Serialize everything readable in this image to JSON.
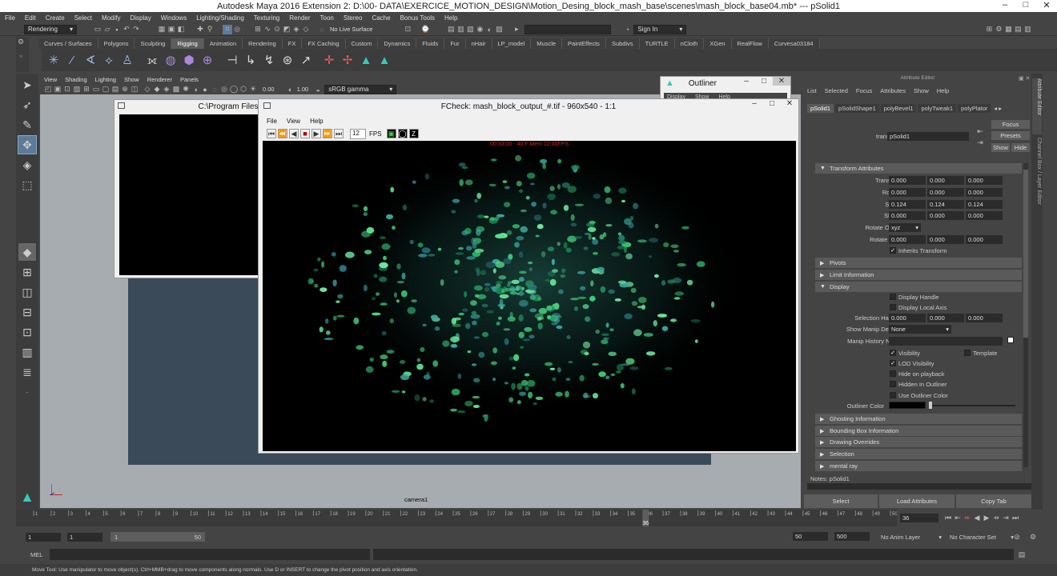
{
  "title": "Autodesk Maya 2016 Extension 2: D:\\00- DATA\\EXERCICE_MOTION_DESIGN\\Motion_Desing_block_mash_base\\scenes\\mash_block_base04.mb*  ---  pSolid1",
  "window_controls": [
    "–",
    "□",
    "✕"
  ],
  "menus": [
    "File",
    "Edit",
    "Create",
    "Select",
    "Modify",
    "Display",
    "Windows",
    "Lighting/Shading",
    "Texturing",
    "Render",
    "Toon",
    "Stereo",
    "Cache",
    "Bonus Tools",
    "Help"
  ],
  "status": {
    "mode": "Rendering",
    "live_surface": "No Live Surface",
    "sign_in": "Sign In"
  },
  "shelf_tabs": [
    "Curves / Surfaces",
    "Polygons",
    "Sculpting",
    "Rigging",
    "Animation",
    "Rendering",
    "FX",
    "FX Caching",
    "Custom",
    "Dynamics",
    "Fluids",
    "Fur",
    "nHair",
    "LP_model",
    "Muscle",
    "PaintEffects",
    "Subdivs",
    "TURTLE",
    "nCloth",
    "XGen",
    "RealFlow",
    "Curvesa03184"
  ],
  "shelf_selected": "Rigging",
  "viewport": {
    "menus": [
      "View",
      "Shading",
      "Lighting",
      "Show",
      "Renderer",
      "Panels"
    ],
    "exposure": "0.00",
    "gamma": "1.00",
    "colorspace": "sRGB gamma",
    "camera": "camera1"
  },
  "outliner": {
    "title": "Outliner",
    "menus": [
      "Display",
      "Show",
      "Help"
    ]
  },
  "program_files": {
    "title": "C:\\Program Files"
  },
  "fcheck": {
    "title": "FCheck: mash_block_output_#.tif - 960x540 - 1:1",
    "menus": [
      "File",
      "View",
      "Help"
    ],
    "fps": "12",
    "fps_label": "FPS",
    "overlay": "00:33:00 - 40 F Mem 12.00FPS"
  },
  "ae": {
    "header": "Attribute Editor",
    "menus": [
      "List",
      "Selected",
      "Focus",
      "Attributes",
      "Show",
      "Help"
    ],
    "tabs": [
      "pSolid1",
      "pSolidShape1",
      "polyBevel1",
      "polyTweak1",
      "polyPlator"
    ],
    "side_buttons": [
      "Focus",
      "Presets",
      "Show",
      "Hide"
    ],
    "transform_label": "transform:",
    "transform_value": "pSolid1",
    "sections": {
      "transform_attrs": "Transform Attributes",
      "pivots": "Pivots",
      "limit": "Limit Information",
      "display": "Display",
      "ghosting": "Ghosting Information",
      "bbox": "Bounding Box Information",
      "overrides": "Drawing Overrides",
      "selection": "Selection",
      "mentalray": "mental ray"
    },
    "translate": {
      "label": "Translate",
      "v": [
        "0.000",
        "0.000",
        "0.000"
      ]
    },
    "rotate": {
      "label": "Rotate",
      "v": [
        "0.000",
        "0.000",
        "0.000"
      ]
    },
    "scale": {
      "label": "Scale",
      "v": [
        "0.124",
        "0.124",
        "0.124"
      ]
    },
    "shear": {
      "label": "Shear",
      "v": [
        "0.000",
        "0.000",
        "0.000"
      ]
    },
    "rotate_order": {
      "label": "Rotate Order",
      "value": "xyz"
    },
    "rotate_axis": {
      "label": "Rotate Axis",
      "v": [
        "0.000",
        "0.000",
        "0.000"
      ]
    },
    "inherits": "Inherits Transform",
    "display_handle": "Display Handle",
    "display_local_axis": "Display Local Axis",
    "selection_handle": {
      "label": "Selection Handle",
      "v": [
        "0.000",
        "0.000",
        "0.000"
      ]
    },
    "show_manip": {
      "label": "Show Manip Default",
      "value": "None"
    },
    "manip_history": "Manip History Node",
    "visibility": "Visibility",
    "template": "Template",
    "lod": "LOD Visibility",
    "hide_playback": "Hide on playback",
    "hidden_outliner": "Hidden In Outliner",
    "use_outliner_color": "Use Outliner Color",
    "outliner_color": "Outliner Color",
    "notes_label": "Notes:",
    "notes_value": "pSolid1",
    "bottom_buttons": [
      "Select",
      "Load Attributes",
      "Copy Tab"
    ]
  },
  "side_tabs": [
    "Attribute Editor",
    "Channel Box / Layer Editor"
  ],
  "timeline": {
    "ticks": [
      "1",
      "2",
      "3",
      "4",
      "5",
      "6",
      "7",
      "8",
      "9",
      "10",
      "11",
      "12",
      "13",
      "14",
      "15",
      "16",
      "17",
      "18",
      "19",
      "20",
      "21",
      "22",
      "23",
      "24",
      "25",
      "26",
      "27",
      "28",
      "29",
      "30",
      "31",
      "32",
      "33",
      "34",
      "35",
      "36",
      "37",
      "38",
      "39",
      "40",
      "41",
      "42",
      "43",
      "44",
      "45",
      "46",
      "47",
      "48",
      "49",
      "50"
    ],
    "current": "36",
    "current_field": "36"
  },
  "range": {
    "start": "1",
    "start2": "1",
    "slider_start": "1",
    "slider_end": "50",
    "end": "50",
    "end2": "500",
    "anim_layer": "No Anim Layer",
    "char_set": "No Character Set"
  },
  "cmd": {
    "lang": "MEL"
  },
  "help": "Move Tool: Use manipulator to move object(s). Ctrl+MMB+drag to move components along normals. Use D or INSERT to change the pivot position and axis orientation."
}
